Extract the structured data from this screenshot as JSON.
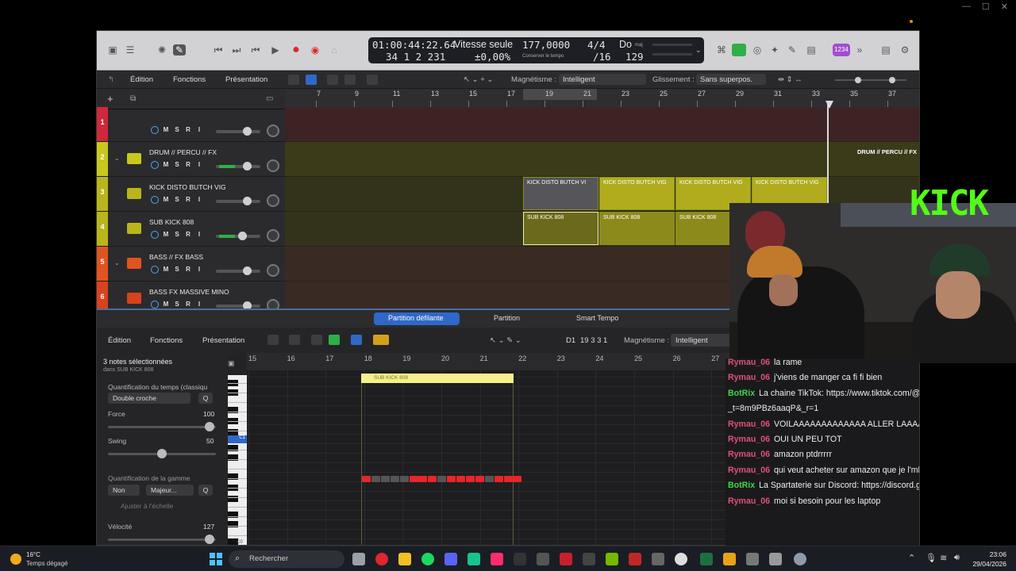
{
  "logic": {
    "lcd": {
      "position": "01:00:44:22.64",
      "bars": "34  1  2  231",
      "mode_title": "Vitesse seule",
      "mode_value": "±0,00%",
      "tempo": "177,0000",
      "tempo_sub": "Conserver le tempo",
      "sig_top": "4/4",
      "sig_bottom": "/16",
      "key_top": "Do",
      "key_top_sub": "maj",
      "key_bottom": "129",
      "purple_label": "1234"
    },
    "editbar": {
      "edition": "Édition",
      "fonctions": "Fonctions",
      "presentation": "Présentation",
      "magnetisme_label": "Magnétisme :",
      "magnetisme_value": "Intelligent",
      "glissement_label": "Glissement :",
      "glissement_value": "Sans superpos."
    },
    "ruler_ticks": [
      "7",
      "9",
      "11",
      "13",
      "15",
      "17",
      "19",
      "21",
      "23",
      "25",
      "27",
      "29",
      "31",
      "33",
      "35",
      "37"
    ],
    "tracks": [
      {
        "num": "1",
        "name": "",
        "color": "#d0283a"
      },
      {
        "num": "2",
        "name": "DRUM // PERCU // FX",
        "color": "#c8c81e"
      },
      {
        "num": "3",
        "name": "KICK DISTO BUTCH VIG",
        "color": "#b9b51a"
      },
      {
        "num": "4",
        "name": "SUB KICK 808",
        "color": "#b9b51a"
      },
      {
        "num": "5",
        "name": "BASS // FX BASS",
        "color": "#e0541e"
      },
      {
        "num": "6",
        "name": "BASS FX MASSIVE MINO",
        "color": "#d9421e"
      }
    ],
    "track_buttons": {
      "m": "M",
      "s": "S",
      "r": "R",
      "i": "I"
    },
    "regions": {
      "drum": "DRUM // PERCU // FX",
      "kick": [
        "KICK DISTO BUTCH VI",
        "KICK DISTO BUTCH VIG",
        "KICK DISTO BUTCH VIG",
        "KICK DISTO BUTCH VIG"
      ],
      "sub": [
        "SUB KICK 808",
        "SUB KICK 808",
        "SUB KICK 808"
      ]
    },
    "piano": {
      "tabs": [
        "Partition défilante",
        "Partition",
        "Smart Tempo"
      ],
      "edition": "Édition",
      "fonctions": "Fonctions",
      "presentation": "Présentation",
      "position": "D1",
      "position_val": "19 3 3 1",
      "magnetisme_label": "Magnétisme :",
      "magnetisme_value": "Intelligent",
      "selected": "3 notes sélectionnées",
      "selected_sub": "dans SUB KICK 808",
      "quant_label": "Quantification du temps (classiqu",
      "quant_value": "Double croche",
      "q_btn": "Q",
      "force_label": "Force",
      "force_value": "100",
      "swing_label": "Swing",
      "swing_value": "50",
      "gamme_label": "Quantification de la gamme",
      "gamme_a": "Non",
      "gamme_b": "Majeur...",
      "ajuster": "Ajuster à l'échelle",
      "velocite_label": "Vélocité",
      "velocite_value": "127",
      "c1": "C1",
      "c0": "C0",
      "ruler_ticks": [
        "15",
        "16",
        "17",
        "18",
        "19",
        "20",
        "21",
        "22",
        "23",
        "24",
        "25",
        "26",
        "27"
      ],
      "region_name": "SUB KICK 808"
    }
  },
  "overlay": {
    "kick_logo": "KICK"
  },
  "chat": [
    {
      "user": "Rymau_06",
      "text": "la rame",
      "color": "#e0507a"
    },
    {
      "user": "Rymau_06",
      "text": "j'viens de manger ca fi fi bien",
      "color": "#e0507a"
    },
    {
      "user": "BotRix",
      "text": "La chaine TikTok: https://www.tiktok.com/@vladoucod?",
      "color": "#42d443"
    },
    {
      "user": "",
      "text": "_t=8m9PBz6aaqP&_r=1",
      "color": "#e0507a"
    },
    {
      "user": "Rymau_06",
      "text": "VOILAAAAAAAAAAAAA ALLER LAAAAAAAAAAAA",
      "color": "#e0507a"
    },
    {
      "user": "Rymau_06",
      "text": "OUI UN PEU TOT",
      "color": "#e0507a"
    },
    {
      "user": "Rymau_06",
      "text": "amazon ptdrrrrr",
      "color": "#e0507a"
    },
    {
      "user": "Rymau_06",
      "text": "qui veut acheter sur amazon que je l'mboucane",
      "color": "#e0507a"
    },
    {
      "user": "BotRix",
      "text": "La Spartaterie sur Discord: https://discord.gg/Vgt7GRkDU3",
      "color": "#42d443"
    },
    {
      "user": "Rymau_06",
      "text": "moi si besoin pour les laptop",
      "color": "#e0507a"
    }
  ],
  "taskbar": {
    "temp": "16°C",
    "weather": "Temps dégagé",
    "search": "Rechercher",
    "time": "23:06",
    "date": "29/04/2026"
  }
}
